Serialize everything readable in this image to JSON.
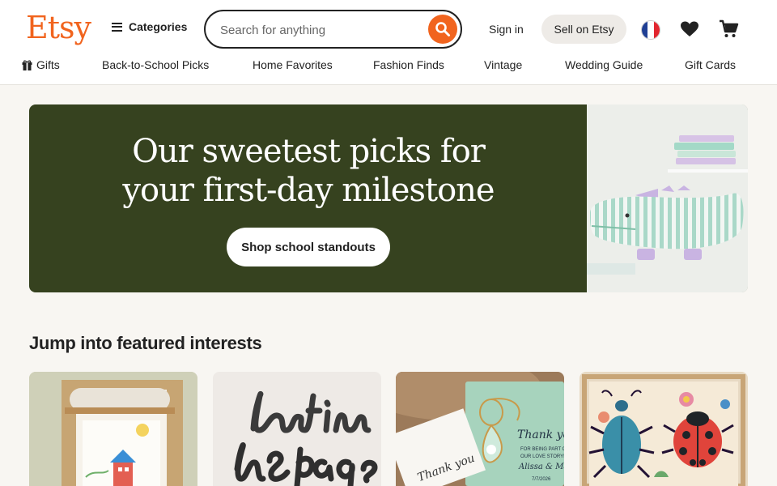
{
  "header": {
    "logo": "Etsy",
    "categories_label": "Categories",
    "search_placeholder": "Search for anything",
    "sign_in_label": "Sign in",
    "sell_label": "Sell on Etsy"
  },
  "nav": {
    "items": [
      {
        "label": "Gifts",
        "icon": "gift-icon"
      },
      {
        "label": "Back-to-School Picks"
      },
      {
        "label": "Home Favorites"
      },
      {
        "label": "Fashion Finds"
      },
      {
        "label": "Vintage"
      },
      {
        "label": "Wedding Guide"
      },
      {
        "label": "Gift Cards"
      }
    ]
  },
  "hero": {
    "title_line1": "Our sweetest picks for",
    "title_line2": "your first-day milestone",
    "button_label": "Shop school standouts"
  },
  "featured": {
    "title": "Jump into featured interests",
    "cards": [
      {
        "image": "kids-art-easel-paper-roll"
      },
      {
        "image": "lost-in-the-pages-script-sign"
      },
      {
        "image": "thank-you-tag-keychain"
      },
      {
        "image": "beetle-ladybug-art-print"
      }
    ]
  },
  "colors": {
    "brand": "#f1641e",
    "hero_bg": "#36421f"
  }
}
